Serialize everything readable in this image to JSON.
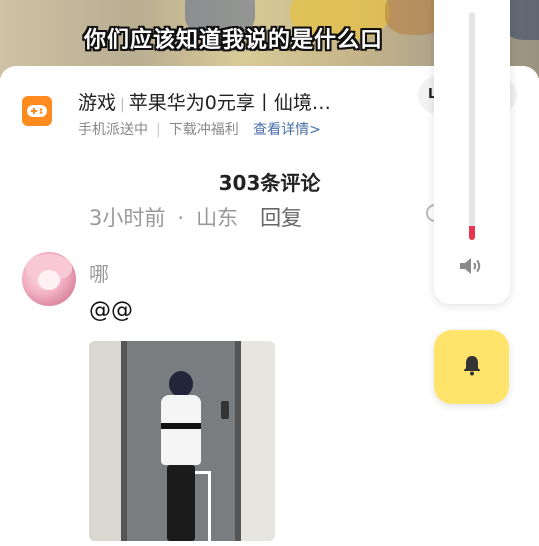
{
  "video": {
    "subtitle": "你们应该知道我说的是什么口"
  },
  "ad": {
    "icon": "gamepad-icon",
    "title_a": "游戏",
    "title_b": "苹果华为0元享丨仙境…",
    "sub_a": "手机派送中",
    "sub_b": "下载冲福利",
    "link": "查看详情>",
    "pill": "L"
  },
  "comments": {
    "count_label": "303条评论",
    "meta_time": "3小时前",
    "meta_dot": "·",
    "meta_location": "山东",
    "reply_label": "回复"
  },
  "comment": {
    "username": "哪",
    "text": "@@"
  },
  "volume": {
    "level_percent": 6,
    "icon": "speaker-icon"
  },
  "bell": {
    "icon": "bell-icon"
  },
  "colors": {
    "accent_red": "#e8384f",
    "bell_yellow": "#ffe46b",
    "ad_orange": "#ff8a1e",
    "link_blue": "#4a6ea8"
  }
}
